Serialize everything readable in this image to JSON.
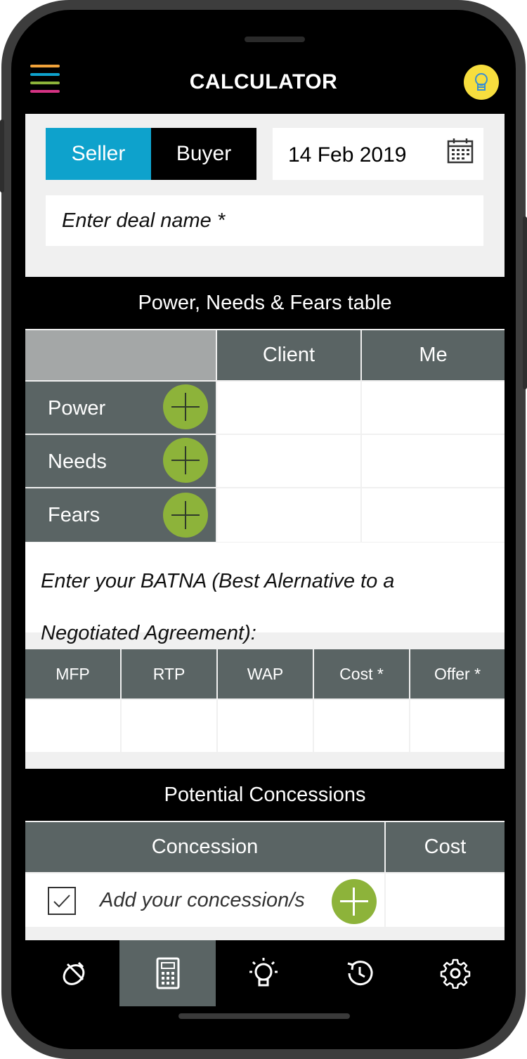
{
  "header": {
    "title": "CALCULATOR"
  },
  "toggle": {
    "seller": "Seller",
    "buyer": "Buyer"
  },
  "date": "14 Feb 2019",
  "deal": {
    "placeholder": "Enter deal name *"
  },
  "pnf": {
    "title": "Power, Needs & Fears table",
    "columns": [
      "Client",
      "Me"
    ],
    "rows": [
      "Power",
      "Needs",
      "Fears"
    ]
  },
  "batna": {
    "prompt": "Enter your BATNA (Best Alernative to a Negotiated Agreement):"
  },
  "metrics": {
    "columns": [
      "MFP",
      "RTP",
      "WAP",
      "Cost *",
      "Offer *"
    ]
  },
  "concessions": {
    "title": "Potential Concessions",
    "col_concession": "Concession",
    "col_cost": "Cost",
    "placeholder": "Add your concession/s",
    "checked": true
  },
  "nav": {
    "items": [
      "deal-icon",
      "calculator-icon",
      "lightbulb-icon",
      "history-icon",
      "settings-icon"
    ],
    "active": "calculator-icon"
  },
  "colors": {
    "accent_blue": "#0ea2cc",
    "green": "#8db33a",
    "slate": "#5a6464",
    "bulb": "#f7de3e"
  }
}
